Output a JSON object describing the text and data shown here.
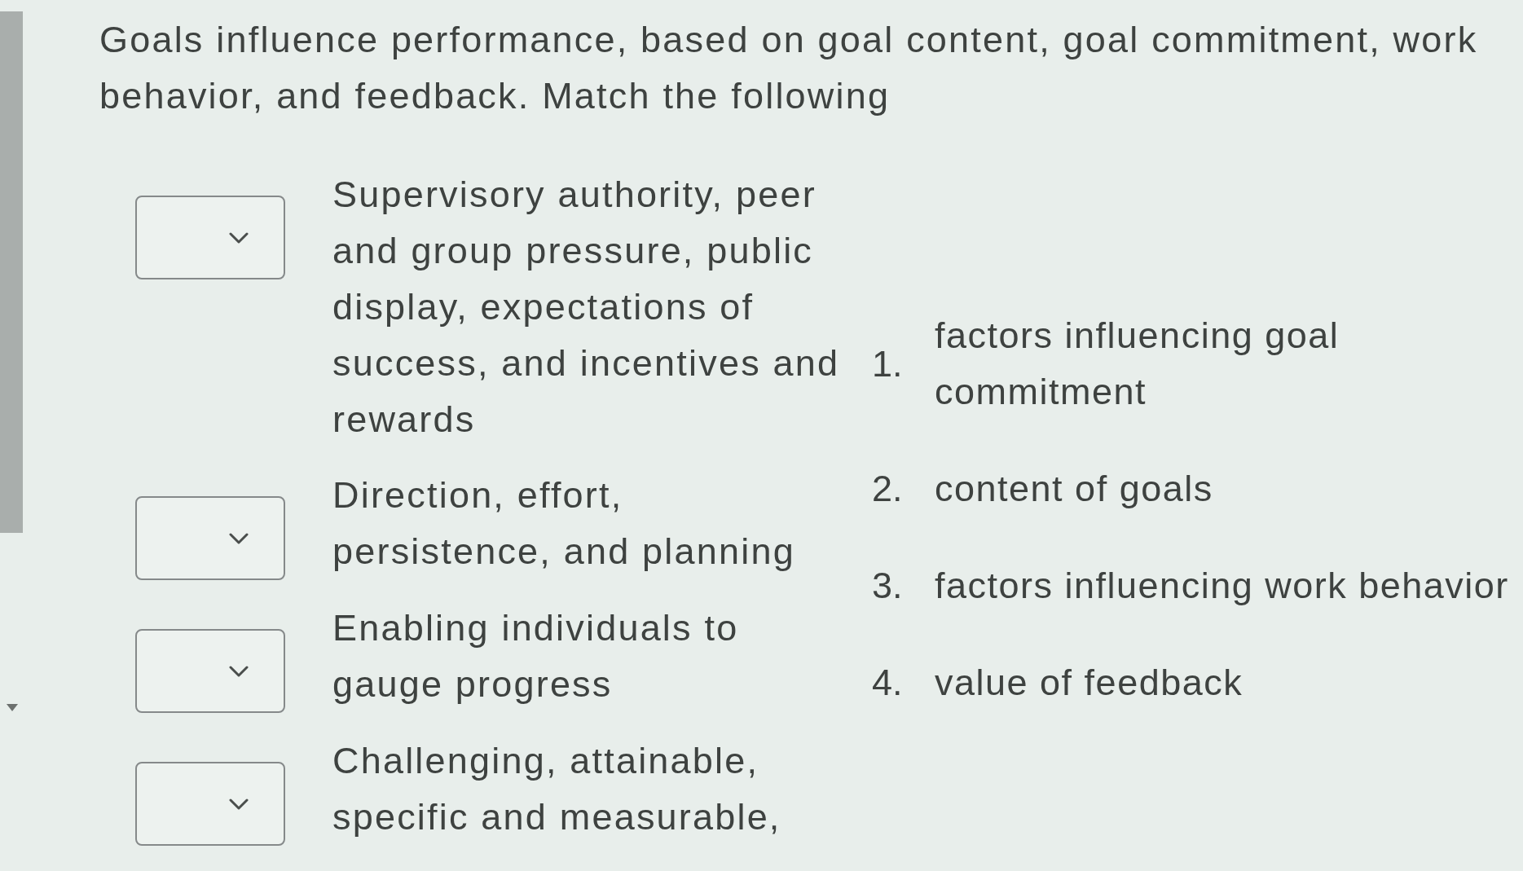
{
  "question": "Goals influence performance, based on goal content, goal commitment, work behavior, and feedback. Match the following",
  "prompts": [
    {
      "text": "Supervisory authority, peer and group pressure, public display, expectations of success, and incentives and rewards"
    },
    {
      "text": "Direction, effort, persistence, and planning"
    },
    {
      "text": "Enabling individuals to gauge progress"
    },
    {
      "text": "Challenging, attainable, specific and measurable,"
    }
  ],
  "answers": [
    {
      "number": "1.",
      "text": "factors influencing goal commitment"
    },
    {
      "number": "2.",
      "text": "content of goals"
    },
    {
      "number": "3.",
      "text": "factors influencing work behavior"
    },
    {
      "number": "4.",
      "text": "value of feedback"
    }
  ]
}
